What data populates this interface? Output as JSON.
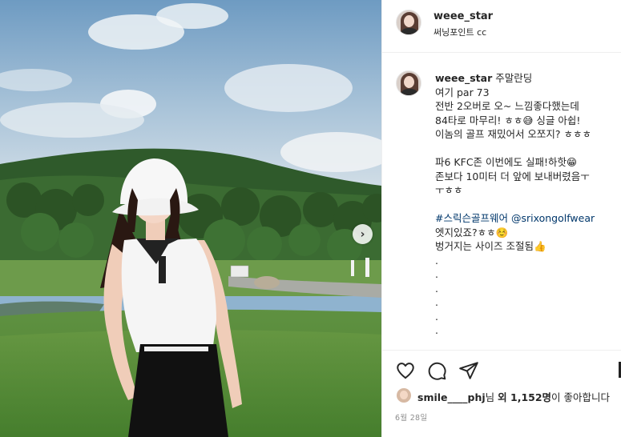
{
  "post": {
    "username": "weee_star",
    "location": "써닝포인트 cc",
    "image_alt": "golf course photo",
    "next_icon": "chevron-right-icon"
  },
  "caption": {
    "username": "weee_star",
    "title": "주말란딩",
    "line1": "여기 par 73",
    "line2": "전반 2오버로 오~ 느낌좋다했는데",
    "line3": "84타로 마무리! ㅎㅎ😅 싱글 아쉽!",
    "line4": "이놈의 골프 재밌어서 오쪼지? ㅎㅎㅎ",
    "line5": "파6 KFC존 이번에도 실패!하핫😁",
    "line6": "존보다 10미터 더 앞에 보내버렸음ㅜ",
    "line7": "ㅜㅎㅎ",
    "hashtag": "#스릭슨골프웨어",
    "mention": "@srixongolfwear",
    "line8": "엣지있죠?ㅎㅎ☺️",
    "line9": "벙거지는 사이즈 조절됨👍",
    "dots": [
      ".",
      ".",
      ".",
      ".",
      ".",
      "."
    ]
  },
  "actions": {
    "like_icon": "heart-icon",
    "comment_icon": "comment-icon",
    "share_icon": "send-icon"
  },
  "likes": {
    "first_user": "smile____phj",
    "suffix_1": "님 ",
    "bold_part": "외 1,152명",
    "suffix_2": "이 좋아합니다"
  },
  "date": "6월 28일"
}
